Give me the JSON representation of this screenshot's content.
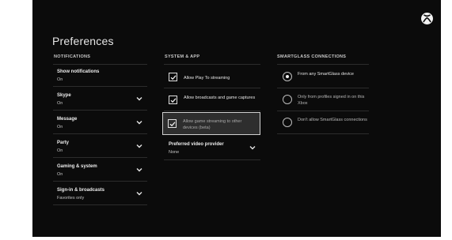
{
  "page_title": "Preferences",
  "notifications": {
    "header": "NOTIFICATIONS",
    "items": [
      {
        "label": "Show notifications",
        "value": "On",
        "expandable": false
      },
      {
        "label": "Skype",
        "value": "On",
        "expandable": true
      },
      {
        "label": "Message",
        "value": "On",
        "expandable": true
      },
      {
        "label": "Party",
        "value": "On",
        "expandable": true
      },
      {
        "label": "Gaming & system",
        "value": "On",
        "expandable": true
      },
      {
        "label": "Sign-in & broadcasts",
        "value": "Favorites only",
        "expandable": true
      }
    ]
  },
  "system_app": {
    "header": "SYSTEM & APP",
    "checkboxes": [
      {
        "label": "Allow Play To streaming",
        "checked": true
      },
      {
        "label": "Allow broadcasts and game captures",
        "checked": true
      },
      {
        "label": "Allow game streaming to other devices (beta)",
        "checked": true,
        "focused": true
      }
    ],
    "video_provider": {
      "label": "Preferred video provider",
      "value": "None"
    }
  },
  "smartglass": {
    "header": "SMARTGLASS CONNECTIONS",
    "options": [
      {
        "label": "From any SmartGlass device",
        "selected": true
      },
      {
        "label": "Only from profiles signed in on this Xbox",
        "selected": false
      },
      {
        "label": "Don't allow SmartGlass connections",
        "selected": false
      }
    ]
  },
  "icons": {
    "logo": "xbox-logo-icon",
    "expand": "chevron-down-icon",
    "check": "checkmark-icon"
  },
  "colors": {
    "background": "#0b0b0b",
    "focus_border": "#d0d0d0",
    "text": "#e8e8e8"
  }
}
